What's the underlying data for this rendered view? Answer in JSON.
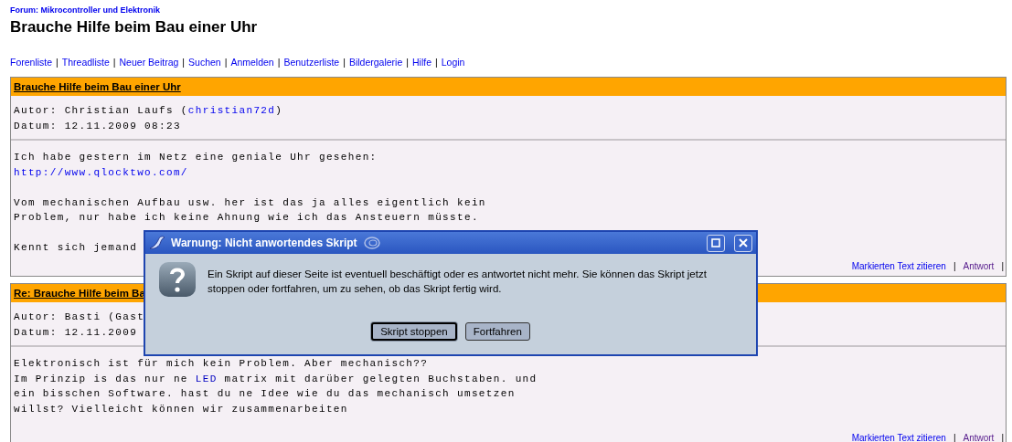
{
  "forum_link": "Forum: Mikrocontroller und Elektronik",
  "page_title": "Brauche Hilfe beim Bau einer Uhr",
  "nav": {
    "separator": "|",
    "links": [
      "Forenliste",
      "Threadliste",
      "Neuer Beitrag",
      "Suchen",
      "Anmelden",
      "Benutzerliste",
      "Bildergalerie",
      "Hilfe",
      "Login"
    ]
  },
  "posts": [
    {
      "title": "Brauche Hilfe beim Bau einer Uhr",
      "author_label": "Autor: Christian Laufs (",
      "author_link": "christian72d",
      "author_suffix": ")",
      "date": "Datum: 12.11.2009 08:23",
      "body": [
        {
          "kind": "text",
          "text": "Ich habe gestern im Netz eine geniale Uhr gesehen:"
        },
        {
          "kind": "link",
          "text": "http://www.qlocktwo.com/"
        },
        {
          "kind": "blank"
        },
        {
          "kind": "text",
          "text": "Vom mechanischen Aufbau usw. her ist das ja alles eigentlich kein"
        },
        {
          "kind": "text",
          "text": "Problem, nur habe ich keine Ahnung wie ich das Ansteuern müsste."
        },
        {
          "kind": "blank"
        },
        {
          "kind": "text",
          "text": "Kennt sich jemand"
        }
      ],
      "actions": {
        "quote": "Markierten Text zitieren",
        "reply": "Antwort",
        "separator": "|"
      }
    },
    {
      "title": "Re: Brauche Hilfe beim Ba",
      "author_label": "Autor: Basti (Gast",
      "date": "Datum: 12.11.2009",
      "body": [
        {
          "kind": "text",
          "text": "Elektronisch ist für mich kein Problem. Aber mechanisch??"
        },
        {
          "kind": "mixed",
          "parts": [
            {
              "kind": "text",
              "text": "Im Prinzip is das nur ne "
            },
            {
              "kind": "link",
              "text": "LED"
            },
            {
              "kind": "text",
              "text": " matrix mit darüber gelegten Buchstaben. und"
            }
          ]
        },
        {
          "kind": "text",
          "text": "ein bisschen Software. hast du ne Idee wie du das mechanisch umsetzen"
        },
        {
          "kind": "text",
          "text": "willst? Vielleicht können wir zusammenarbeiten"
        }
      ],
      "actions": {
        "quote": "Markierten Text zitieren",
        "reply": "Antwort",
        "separator": "|"
      }
    }
  ],
  "dialog": {
    "title": "Warnung: Nicht anwortendes Skript",
    "message": "Ein Skript auf dieser Seite ist eventuell beschäftigt oder es antwortet nicht mehr. Sie können das Skript jetzt stoppen oder fortfahren, um zu sehen, ob das Skript fertig wird.",
    "buttons": [
      {
        "label": "Skript stoppen",
        "selected": true
      },
      {
        "label": "Fortfahren",
        "selected": false
      }
    ]
  }
}
